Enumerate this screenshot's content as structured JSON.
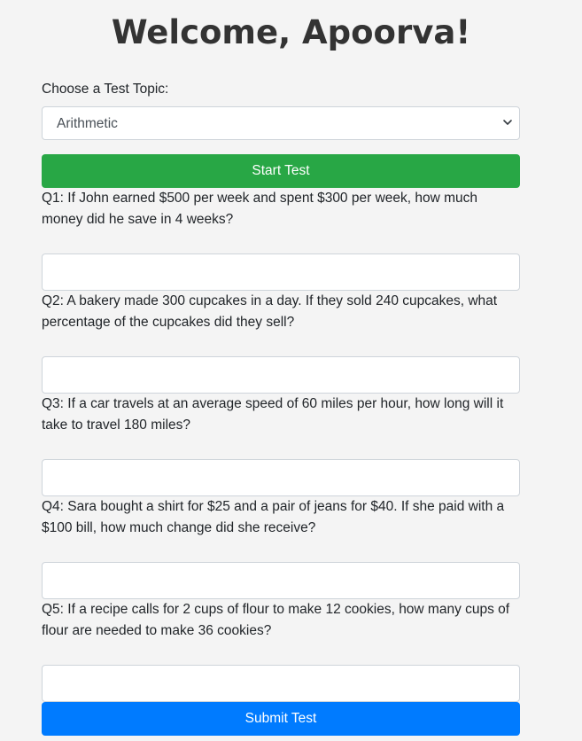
{
  "header": {
    "title": "Welcome, Apoorva!"
  },
  "topic": {
    "label": "Choose a Test Topic:",
    "selected": "Arithmetic"
  },
  "actions": {
    "start_label": "Start Test",
    "submit_label": "Submit Test"
  },
  "questions": [
    {
      "text": "Q1: If John earned $500 per week and spent $300 per week, how much money did he save in 4 weeks?",
      "answer": ""
    },
    {
      "text": "Q2: A bakery made 300 cupcakes in a day. If they sold 240 cupcakes, what percentage of the cupcakes did they sell?",
      "answer": ""
    },
    {
      "text": "Q3: If a car travels at an average speed of 60 miles per hour, how long will it take to travel 180 miles?",
      "answer": ""
    },
    {
      "text": "Q4: Sara bought a shirt for $25 and a pair of jeans for $40. If she paid with a $100 bill, how much change did she receive?",
      "answer": ""
    },
    {
      "text": "Q5: If a recipe calls for 2 cups of flour to make 12 cookies, how many cups of flour are needed to make 36 cookies?",
      "answer": ""
    }
  ],
  "icons": {
    "select_chevron": "chevron-down-icon"
  }
}
